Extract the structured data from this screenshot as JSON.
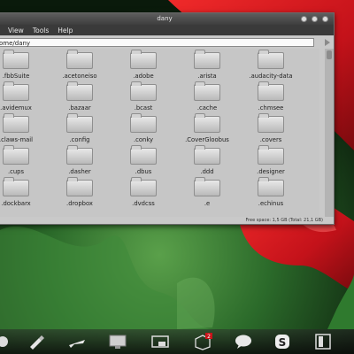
{
  "window": {
    "title": "dany",
    "menu": [
      "View",
      "Tools",
      "Help"
    ],
    "location": "ome/dany",
    "status": "Free space: 1,5 GB (Total: 21,1 GB)"
  },
  "files": [
    ".fbbSuite",
    ".acetoneiso",
    ".adobe",
    ".arista",
    ".audacity-data",
    ".avidemux",
    ".bazaar",
    ".bcast",
    ".cache",
    ".chmsee",
    ".claws-mail",
    ".config",
    ".conky",
    ".CoverGloobus",
    ".covers",
    ".cups",
    ".dasher",
    ".dbus",
    ".ddd",
    ".designer",
    ".dockbarx",
    ".dropbox",
    ".dvdcss",
    ".e",
    ".echinus"
  ],
  "dock": {
    "badge": "2",
    "items": [
      "partial-icon",
      "pen-icon",
      "plane-icon",
      "monitor-icon",
      "screen-icon",
      "package-icon",
      "chat-icon",
      "skype-icon",
      "book-icon"
    ]
  },
  "colors": {
    "accent_red": "#c8141a",
    "folder_gray": "#d4d4d4",
    "window_bg": "#c6c6c6",
    "titlebar": "#4a4a4a"
  }
}
